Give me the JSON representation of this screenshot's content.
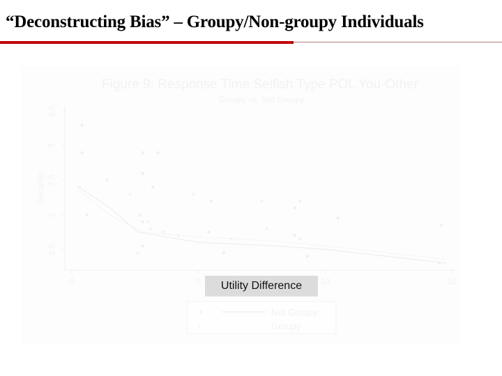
{
  "slide": {
    "title": "“Deconstructing Bias” – Groupy/Non-groupy Individuals",
    "accent_color": "#c00000"
  },
  "chart_data": {
    "type": "scatter",
    "title": "Figure 9: Response Time Selfish Type POL You-Other",
    "subtitle": "Groupy vs. Not Groupy",
    "xlabel": "Utility Difference",
    "ylabel": "Seconds",
    "xlim": [
      0,
      15
    ],
    "ylim": [
      1.2,
      3.5
    ],
    "xticks": [
      "0",
      "5",
      "10",
      "15"
    ],
    "xtick_values": [
      0,
      5,
      10,
      15
    ],
    "yticks": [
      "1.5",
      "2",
      "2.5",
      "3",
      "3.5"
    ],
    "ytick_values": [
      1.5,
      2,
      2.5,
      3,
      3.5
    ],
    "grid": false,
    "legend_position": "bottom",
    "series": [
      {
        "name": "Not Groupy",
        "marker": "dot",
        "points": [
          [
            0.4,
            3.3
          ],
          [
            0.4,
            2.9
          ],
          [
            2.8,
            2.9
          ],
          [
            3.4,
            2.9
          ],
          [
            2.8,
            2.6
          ],
          [
            3.2,
            2.4
          ],
          [
            5.5,
            2.2
          ],
          [
            9.0,
            2.2
          ],
          [
            8.8,
            2.1
          ],
          [
            0.6,
            2.0
          ],
          [
            10.5,
            1.95
          ],
          [
            14.6,
            1.85
          ],
          [
            2.8,
            1.9
          ],
          [
            5.4,
            1.75
          ],
          [
            8.8,
            1.7
          ],
          [
            2.8,
            1.55
          ],
          [
            6.0,
            1.45
          ],
          [
            9.3,
            1.4
          ],
          [
            14.5,
            1.3
          ]
        ],
        "fit": [
          [
            0.3,
            2.4
          ],
          [
            1.5,
            2.1
          ],
          [
            2.6,
            1.75
          ],
          [
            5.0,
            1.6
          ],
          [
            8.0,
            1.55
          ],
          [
            10.0,
            1.5
          ],
          [
            14.8,
            1.3
          ]
        ]
      },
      {
        "name": "Groupy",
        "marker": "x",
        "points": [
          [
            0.3,
            2.4
          ],
          [
            1.4,
            2.5
          ],
          [
            2.3,
            2.3
          ],
          [
            2.7,
            2.0
          ],
          [
            3.1,
            1.8
          ],
          [
            3.6,
            1.75
          ],
          [
            4.2,
            1.7
          ],
          [
            6.3,
            1.65
          ],
          [
            7.7,
            1.8
          ],
          [
            9.0,
            1.65
          ],
          [
            2.6,
            1.45
          ],
          [
            7.5,
            2.2
          ],
          [
            4.8,
            2.3
          ],
          [
            3.0,
            1.9
          ]
        ],
        "fit": [
          [
            0.3,
            2.35
          ],
          [
            1.5,
            2.0
          ],
          [
            2.8,
            1.75
          ],
          [
            5.0,
            1.68
          ],
          [
            8.0,
            1.62
          ],
          [
            10.0,
            1.55
          ],
          [
            14.8,
            1.35
          ]
        ]
      }
    ]
  }
}
